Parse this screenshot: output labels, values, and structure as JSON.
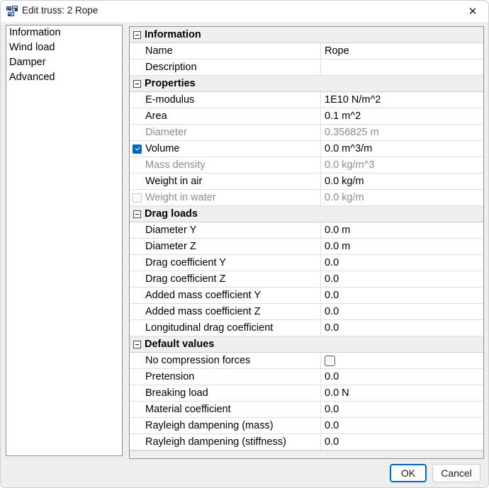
{
  "window": {
    "title": "Edit truss: 2 Rope",
    "icon": "app-window-icon",
    "close_icon": "✕"
  },
  "sidebar": {
    "items": [
      {
        "label": "Information"
      },
      {
        "label": "Wind load"
      },
      {
        "label": "Damper"
      },
      {
        "label": "Advanced"
      }
    ]
  },
  "property_grid": {
    "groups": [
      {
        "label": "Information",
        "collapsed": false,
        "rows": [
          {
            "label": "Name",
            "value": "Rope",
            "disabled": false,
            "checkbox": null,
            "value_checkbox": null
          },
          {
            "label": "Description",
            "value": "",
            "disabled": false,
            "checkbox": null,
            "value_checkbox": null
          }
        ]
      },
      {
        "label": "Properties",
        "collapsed": false,
        "rows": [
          {
            "label": "E-modulus",
            "value": "1E10 N/m^2",
            "disabled": false,
            "checkbox": null,
            "value_checkbox": null
          },
          {
            "label": "Area",
            "value": "0.1 m^2",
            "disabled": false,
            "checkbox": null,
            "value_checkbox": null
          },
          {
            "label": "Diameter",
            "value": "0.356825 m",
            "disabled": true,
            "checkbox": null,
            "value_checkbox": null
          },
          {
            "label": "Volume",
            "value": "0.0 m^3/m",
            "disabled": false,
            "checkbox": "checked",
            "value_checkbox": null
          },
          {
            "label": "Mass density",
            "value": "0.0 kg/m^3",
            "disabled": true,
            "checkbox": null,
            "value_checkbox": null
          },
          {
            "label": "Weight in air",
            "value": "0.0 kg/m",
            "disabled": false,
            "checkbox": null,
            "value_checkbox": null
          },
          {
            "label": "Weight in water",
            "value": "0.0 kg/m",
            "disabled": true,
            "checkbox": "unchecked",
            "value_checkbox": null
          }
        ]
      },
      {
        "label": "Drag loads",
        "collapsed": false,
        "rows": [
          {
            "label": "Diameter Y",
            "value": "0.0 m",
            "disabled": false,
            "checkbox": null,
            "value_checkbox": null
          },
          {
            "label": "Diameter Z",
            "value": "0.0 m",
            "disabled": false,
            "checkbox": null,
            "value_checkbox": null
          },
          {
            "label": "Drag coefficient Y",
            "value": "0.0",
            "disabled": false,
            "checkbox": null,
            "value_checkbox": null
          },
          {
            "label": "Drag coefficient Z",
            "value": "0.0",
            "disabled": false,
            "checkbox": null,
            "value_checkbox": null
          },
          {
            "label": "Added mass coefficient Y",
            "value": "0.0",
            "disabled": false,
            "checkbox": null,
            "value_checkbox": null
          },
          {
            "label": "Added mass coefficient Z",
            "value": "0.0",
            "disabled": false,
            "checkbox": null,
            "value_checkbox": null
          },
          {
            "label": "Longitudinal drag coefficient",
            "value": "0.0",
            "disabled": false,
            "checkbox": null,
            "value_checkbox": null
          }
        ]
      },
      {
        "label": "Default values",
        "collapsed": false,
        "rows": [
          {
            "label": "No compression forces",
            "value": "",
            "disabled": false,
            "checkbox": null,
            "value_checkbox": "unchecked"
          },
          {
            "label": "Pretension",
            "value": "0.0",
            "disabled": false,
            "checkbox": null,
            "value_checkbox": null
          },
          {
            "label": "Breaking load",
            "value": "0.0 N",
            "disabled": false,
            "checkbox": null,
            "value_checkbox": null
          },
          {
            "label": "Material coefficient",
            "value": "0.0",
            "disabled": false,
            "checkbox": null,
            "value_checkbox": null
          },
          {
            "label": "Rayleigh dampening (mass)",
            "value": "0.0",
            "disabled": false,
            "checkbox": null,
            "value_checkbox": null
          },
          {
            "label": "Rayleigh dampening (stiffness)",
            "value": "0.0",
            "disabled": false,
            "checkbox": null,
            "value_checkbox": null
          }
        ]
      }
    ]
  },
  "footer": {
    "ok_label": "OK",
    "cancel_label": "Cancel"
  },
  "colors": {
    "accent": "#0067c0",
    "group_header_bg": "#efefef",
    "dialog_bg": "#eeeeee",
    "disabled_text": "#8d8d8d",
    "border": "#8c9096"
  }
}
